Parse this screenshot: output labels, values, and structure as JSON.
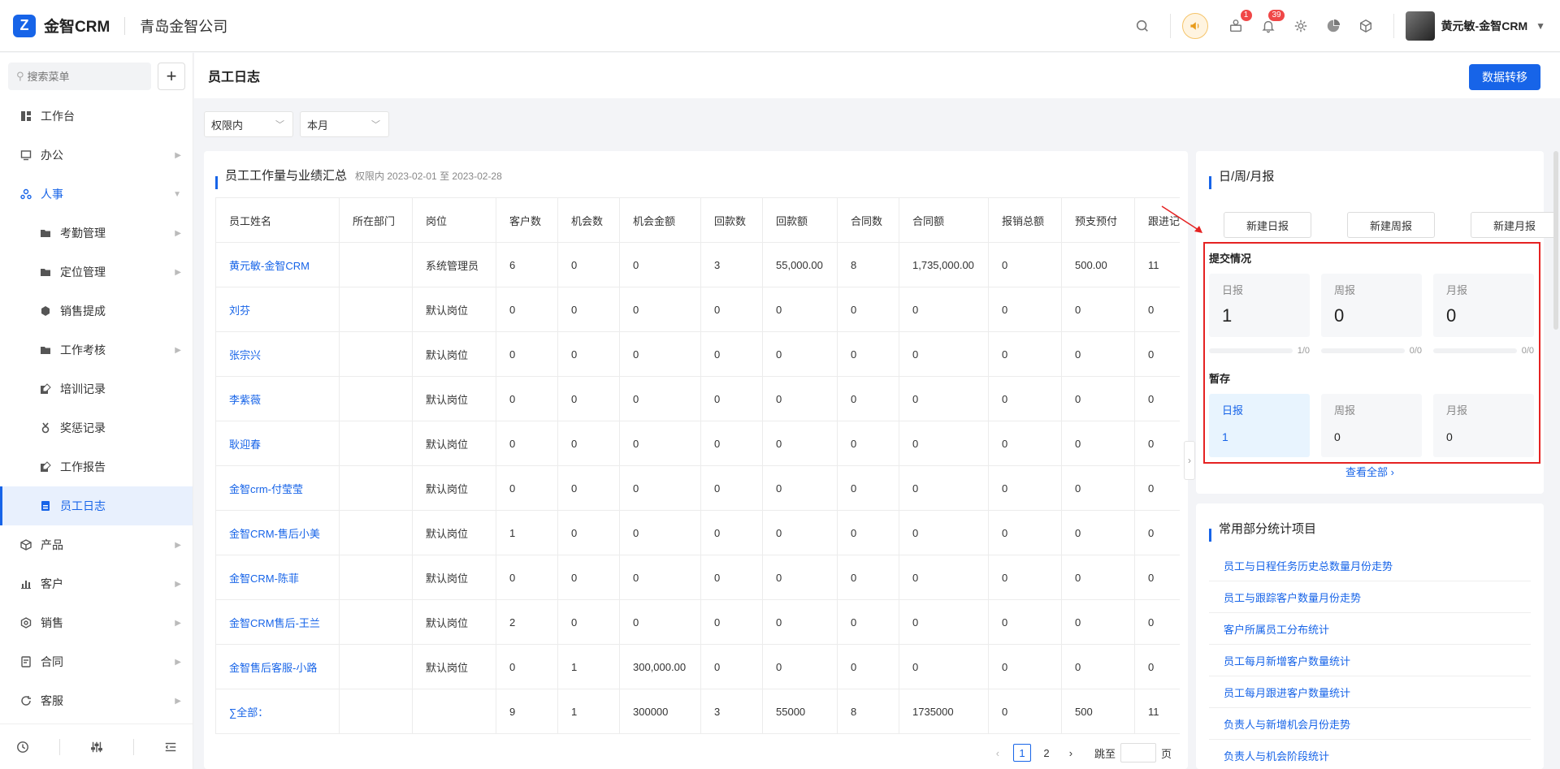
{
  "app": {
    "logo_text": "金智CRM",
    "company": "青岛金智公司"
  },
  "header": {
    "badges": {
      "messages": "1",
      "notifications": "39"
    },
    "user_name": "黄元敏-金智CRM"
  },
  "sidebar": {
    "search_placeholder": "搜索菜单",
    "items": [
      {
        "label": "工作台"
      },
      {
        "label": "办公"
      },
      {
        "label": "人事"
      },
      {
        "label": "考勤管理"
      },
      {
        "label": "定位管理"
      },
      {
        "label": "销售提成"
      },
      {
        "label": "工作考核"
      },
      {
        "label": "培训记录"
      },
      {
        "label": "奖惩记录"
      },
      {
        "label": "工作报告"
      },
      {
        "label": "员工日志"
      },
      {
        "label": "产品"
      },
      {
        "label": "客户"
      },
      {
        "label": "销售"
      },
      {
        "label": "合同"
      },
      {
        "label": "客服"
      }
    ]
  },
  "page": {
    "title": "员工日志",
    "transfer_button": "数据转移",
    "filters": {
      "scope": "权限内",
      "period": "本月"
    }
  },
  "summary": {
    "title": "员工工作量与业绩汇总",
    "subtitle": "权限内 2023-02-01 至 2023-02-28",
    "columns": [
      "员工姓名",
      "所在部门",
      "岗位",
      "客户数",
      "机会数",
      "机会金额",
      "回款数",
      "回款额",
      "合同数",
      "合同额",
      "报销总额",
      "预支预付",
      "跟进记"
    ],
    "rows": [
      [
        "黄元敏-金智CRM",
        "",
        "系统管理员",
        "6",
        "0",
        "0",
        "3",
        "55,000.00",
        "8",
        "1,735,000.00",
        "0",
        "500.00",
        "11"
      ],
      [
        "刘芬",
        "",
        "默认岗位",
        "0",
        "0",
        "0",
        "0",
        "0",
        "0",
        "0",
        "0",
        "0",
        "0"
      ],
      [
        "张宗兴",
        "",
        "默认岗位",
        "0",
        "0",
        "0",
        "0",
        "0",
        "0",
        "0",
        "0",
        "0",
        "0"
      ],
      [
        "李紫薇",
        "",
        "默认岗位",
        "0",
        "0",
        "0",
        "0",
        "0",
        "0",
        "0",
        "0",
        "0",
        "0"
      ],
      [
        "耿迎春",
        "",
        "默认岗位",
        "0",
        "0",
        "0",
        "0",
        "0",
        "0",
        "0",
        "0",
        "0",
        "0"
      ],
      [
        "金智crm-付莹莹",
        "",
        "默认岗位",
        "0",
        "0",
        "0",
        "0",
        "0",
        "0",
        "0",
        "0",
        "0",
        "0"
      ],
      [
        "金智CRM-售后小美",
        "",
        "默认岗位",
        "1",
        "0",
        "0",
        "0",
        "0",
        "0",
        "0",
        "0",
        "0",
        "0"
      ],
      [
        "金智CRM-陈菲",
        "",
        "默认岗位",
        "0",
        "0",
        "0",
        "0",
        "0",
        "0",
        "0",
        "0",
        "0",
        "0"
      ],
      [
        "金智CRM售后-王兰",
        "",
        "默认岗位",
        "2",
        "0",
        "0",
        "0",
        "0",
        "0",
        "0",
        "0",
        "0",
        "0"
      ],
      [
        "金智售后客服-小路",
        "",
        "默认岗位",
        "0",
        "1",
        "300,000.00",
        "0",
        "0",
        "0",
        "0",
        "0",
        "0",
        "0"
      ],
      [
        "∑全部：",
        "",
        "",
        "9",
        "1",
        "300000",
        "3",
        "55000",
        "8",
        "1735000",
        "0",
        "500",
        "11"
      ]
    ],
    "pagination": {
      "pages": [
        "1",
        "2"
      ],
      "current": "1",
      "jump_label": "跳至",
      "page_suffix": "页"
    }
  },
  "reports": {
    "title": "日/周/月报",
    "buttons": [
      "新建日报",
      "新建周报",
      "新建月报"
    ],
    "submitted": {
      "label": "提交情况",
      "items": [
        {
          "name": "日报",
          "value": "1",
          "ratio": "1/0"
        },
        {
          "name": "周报",
          "value": "0",
          "ratio": "0/0"
        },
        {
          "name": "月报",
          "value": "0",
          "ratio": "0/0"
        }
      ]
    },
    "drafts": {
      "label": "暂存",
      "items": [
        {
          "name": "日报",
          "value": "1"
        },
        {
          "name": "周报",
          "value": "0"
        },
        {
          "name": "月报",
          "value": "0"
        }
      ]
    },
    "view_all": "查看全部"
  },
  "stats": {
    "title": "常用部分统计项目",
    "items": [
      "员工与日程任务历史总数量月份走势",
      "员工与跟踪客户数量月份走势",
      "客户所属员工分布统计",
      "员工每月新增客户数量统计",
      "员工每月跟进客户数量统计",
      "负责人与新增机会月份走势",
      "负责人与机会阶段统计"
    ]
  },
  "colors": {
    "accent": "#1764e8",
    "highlight_frame": "#e52222",
    "badge": "#f04747"
  }
}
